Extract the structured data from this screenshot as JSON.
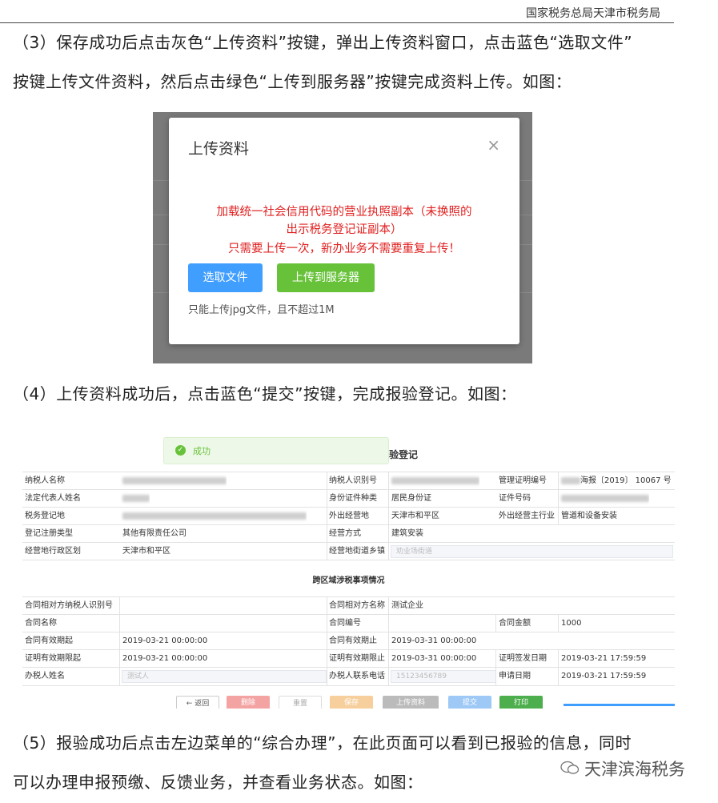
{
  "header": {
    "org": "国家税务总局天津市税务局"
  },
  "step3": {
    "line1": "（3）保存成功后点击灰色“上传资料”按键，弹出上传资料窗口，点击蓝色“选取文件”",
    "line2": "按键上传文件资料，然后点击绿色“上传到服务器”按键完成资料上传。如图："
  },
  "upload_modal": {
    "title": "上传资料",
    "close": "×",
    "msg_line1": "加载统一社会信用代码的营业执照副本（未换照的",
    "msg_line2": "出示税务登记证副本）",
    "msg_line3": "只需要上传一次，新办业务不需要重复上传！",
    "select_label": "选取文件",
    "upload_label": "上传到服务器",
    "hint": "只能上传jpg文件，且不超过1M",
    "colors": {
      "blue": "#409eff",
      "green": "#67c23a",
      "red": "#e02020"
    }
  },
  "step4": {
    "line1": "（4）上传资料成功后，点击蓝色“提交”按键，完成报验登记。如图："
  },
  "form": {
    "toast": "成功",
    "title": "验登记",
    "rows": {
      "r1": {
        "c1": "纳税人名称",
        "c3": "纳税人识别号",
        "c5": "管理证明编号",
        "c6_suffix": "海报〔2019〕 10067 号"
      },
      "r2": {
        "c1": "法定代表人姓名",
        "c3": "身份证件种类",
        "c4": "居民身份证",
        "c5": "证件号码"
      },
      "r3": {
        "c1": "税务登记地",
        "c3": "外出经营地",
        "c4": "天津市和平区",
        "c5": "外出经营主行业",
        "c6": "管道和设备安装"
      },
      "r4": {
        "c1": "登记注册类型",
        "c2": "其他有限责任公司",
        "c3": "经营方式",
        "c4": "建筑安装"
      },
      "r5": {
        "c1": "经营地行政区划",
        "c2": "天津市和平区",
        "c3": "经营地街道乡镇",
        "c4_placeholder": "劝业场街道"
      },
      "section": "跨区域涉税事项情况",
      "r6": {
        "c1": "合同相对方纳税人识别号",
        "c3": "合同相对方名称",
        "c4": "测试企业"
      },
      "r7": {
        "c1": "合同名称",
        "c3": "合同编号",
        "c5": "合同金额",
        "c6": "1000"
      },
      "r8": {
        "c1": "合同有效期起",
        "c2": "2019-03-21 00:00:00",
        "c3": "合同有效期止",
        "c4": "2019-03-31 00:00:00"
      },
      "r9": {
        "c1": "证明有效期限起",
        "c2": "2019-03-21 00:00:00",
        "c3": "证明有效期限止",
        "c4": "2019-03-31 00:00:00",
        "c5": "证明签发日期",
        "c6": "2019-03-21 17:59:59"
      },
      "r10": {
        "c1": "办税人姓名",
        "c2_placeholder": "测试人",
        "c3": "办税人联系电话",
        "c4_placeholder": "15123456789",
        "c5": "申请日期",
        "c6": "2019-03-21 17:59:59"
      }
    },
    "buttons": {
      "back": "← 返回",
      "delete": "删除",
      "reset": "重置",
      "save": "保存",
      "upload": "上传资料",
      "submit": "提交",
      "print": "打印"
    }
  },
  "step5": {
    "line1": "（5）报验成功后点击左边菜单的“综合办理”，在此页面可以看到已报验的信息，同时",
    "line2": "可以办理申报预缴、反馈业务，并查看业务状态。如图："
  },
  "watermark": "天津滨海税务"
}
